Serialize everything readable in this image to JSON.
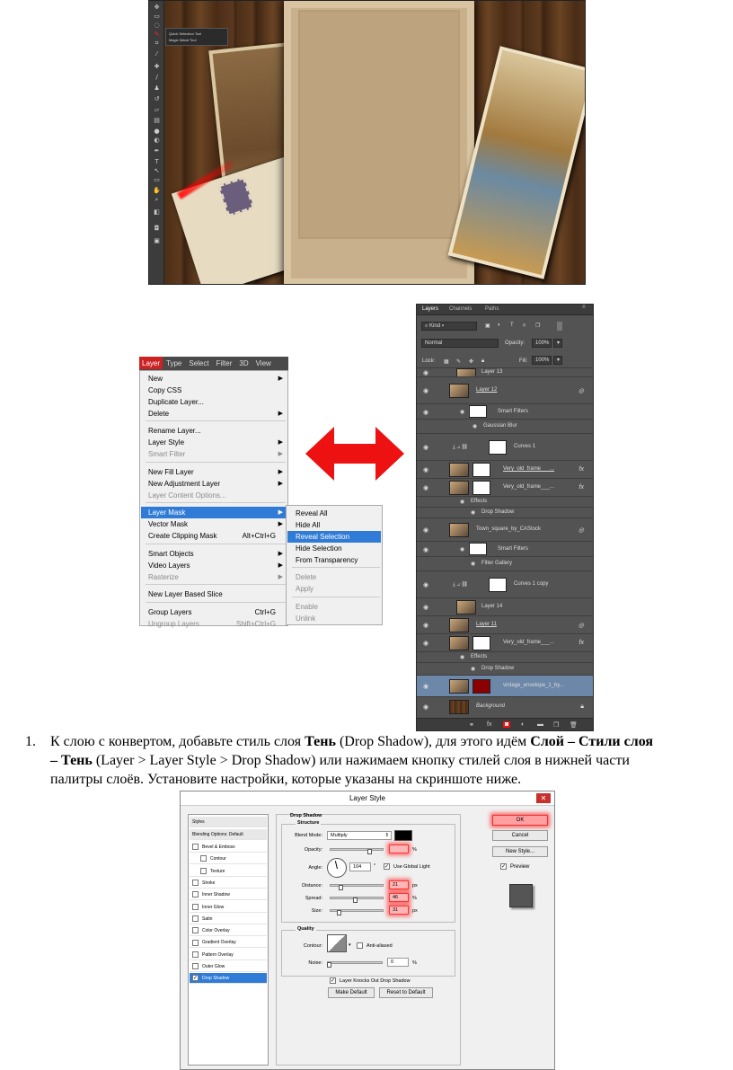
{
  "ps_canvas": {
    "tools_flyout": [
      "Quick Selection Tool",
      "Magic Wand Tool"
    ]
  },
  "menubar": [
    "Layer",
    "Type",
    "Select",
    "Filter",
    "3D",
    "View"
  ],
  "layer_menu": {
    "items": [
      {
        "label": "New",
        "submenu": true
      },
      {
        "label": "Copy CSS"
      },
      {
        "label": "Duplicate Layer..."
      },
      {
        "label": "Delete",
        "submenu": true
      },
      {
        "label": "Rename Layer..."
      },
      {
        "label": "Layer Style",
        "submenu": true
      },
      {
        "label": "Smart Filter",
        "submenu": true,
        "disabled": true
      },
      {
        "label": "New Fill Layer",
        "submenu": true
      },
      {
        "label": "New Adjustment Layer",
        "submenu": true
      },
      {
        "label": "Layer Content Options...",
        "disabled": true
      },
      {
        "label": "Layer Mask",
        "submenu": true,
        "selected": true
      },
      {
        "label": "Vector Mask",
        "submenu": true
      },
      {
        "label": "Create Clipping Mask",
        "shortcut": "Alt+Ctrl+G"
      },
      {
        "label": "Smart Objects",
        "submenu": true
      },
      {
        "label": "Video Layers",
        "submenu": true
      },
      {
        "label": "Rasterize",
        "submenu": true,
        "disabled": true
      },
      {
        "label": "New Layer Based Slice"
      },
      {
        "label": "Group Layers",
        "shortcut": "Ctrl+G"
      },
      {
        "label": "Ungroup Layers",
        "shortcut": "Shift+Ctrl+G",
        "disabled": true
      }
    ],
    "submenu": [
      {
        "label": "Reveal All"
      },
      {
        "label": "Hide All"
      },
      {
        "label": "Reveal Selection",
        "selected": true
      },
      {
        "label": "Hide Selection"
      },
      {
        "label": "From Transparency"
      },
      {
        "label": "Delete",
        "disabled": true
      },
      {
        "label": "Apply",
        "disabled": true
      },
      {
        "label": "Enable",
        "disabled": true
      },
      {
        "label": "Unlink",
        "disabled": true
      }
    ]
  },
  "layers_panel": {
    "tabs": [
      "Layers",
      "Channels",
      "Paths"
    ],
    "kind": "Kind",
    "blend": "Normal",
    "opacity_label": "Opacity:",
    "opacity": "100%",
    "lock_label": "Lock:",
    "fill_label": "Fill:",
    "fill": "100%",
    "layers": [
      {
        "name": "Layer 13"
      },
      {
        "name": "Layer 12"
      },
      {
        "name": "Smart Filters"
      },
      {
        "name": "Gaussian Blur"
      },
      {
        "name": "Curves 1"
      },
      {
        "name": "Very_old_frame___..."
      },
      {
        "name": "Very_old_frame___..."
      },
      {
        "name": "Effects"
      },
      {
        "name": "Drop Shadow"
      },
      {
        "name": "Town_square_by_CAStock"
      },
      {
        "name": "Smart Filters"
      },
      {
        "name": "Filter Gallery"
      },
      {
        "name": "Curves 1 copy"
      },
      {
        "name": "Layer 14"
      },
      {
        "name": "Layer 11"
      },
      {
        "name": "Very_old_frame___..."
      },
      {
        "name": "Effects"
      },
      {
        "name": "Drop Shadow"
      },
      {
        "name": "vintage_envelope_1_by..."
      },
      {
        "name": "Background"
      }
    ]
  },
  "instruction": {
    "number": "1.",
    "line1_a": "К слою с конвертом, добавьте стиль слоя ",
    "line1_b": "Тень",
    "line1_c": " (Drop Shadow), для этого идём ",
    "line1_d": "Слой – Стили слоя",
    "line2_a": "– Тень",
    "line2_b": " (Layer > Layer Style > Drop Shadow) или нажимаем кнопку стилей слоя в нижней части",
    "line3": "палитры слоёв. Установите настройки, которые указаны на скриншоте ниже."
  },
  "layer_style": {
    "title": "Layer Style",
    "styles_header": "Styles",
    "blending": "Blending Options: Default",
    "list": [
      {
        "label": "Bevel & Emboss",
        "checked": false
      },
      {
        "label": "Contour",
        "checked": false,
        "indent": true
      },
      {
        "label": "Texture",
        "checked": false,
        "indent": true
      },
      {
        "label": "Stroke",
        "checked": false
      },
      {
        "label": "Inner Shadow",
        "checked": false
      },
      {
        "label": "Inner Glow",
        "checked": false
      },
      {
        "label": "Satin",
        "checked": false
      },
      {
        "label": "Color Overlay",
        "checked": false
      },
      {
        "label": "Gradient Overlay",
        "checked": false
      },
      {
        "label": "Pattern Overlay",
        "checked": false
      },
      {
        "label": "Outer Glow",
        "checked": false
      },
      {
        "label": "Drop Shadow",
        "checked": true,
        "selected": true
      }
    ],
    "section": "Drop Shadow",
    "structure": "Structure",
    "blend_mode_label": "Blend Mode:",
    "blend_mode": "Multiply",
    "shadow_color": "#000000",
    "opacity_label": "Opacity:",
    "opacity": "",
    "angle_label": "Angle:",
    "angle": "104",
    "angle_unit": "°",
    "use_global_light": "Use Global Light",
    "distance_label": "Distance:",
    "distance": "21",
    "spread_label": "Spread:",
    "spread": "46",
    "size_label": "Size:",
    "size": "31",
    "unit_px": "px",
    "unit_pct": "%",
    "quality": "Quality",
    "contour_label": "Contour:",
    "anti_aliased": "Anti-aliased",
    "noise_label": "Noise:",
    "noise": "0",
    "knocks_out": "Layer Knocks Out Drop Shadow",
    "make_default": "Make Default",
    "reset_default": "Reset to Default",
    "ok": "OK",
    "cancel": "Cancel",
    "new_style": "New Style...",
    "preview": "Preview",
    "highlight_color": "#ff0000"
  }
}
